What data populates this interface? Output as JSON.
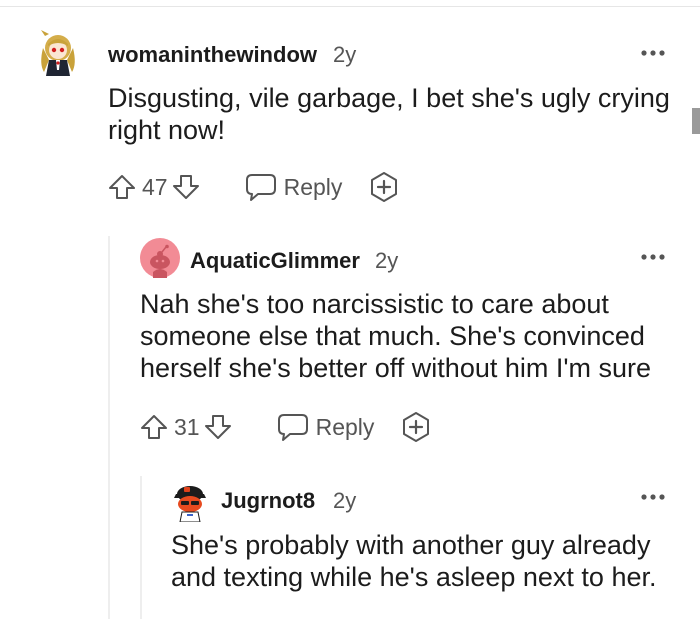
{
  "comments": [
    {
      "username": "womaninthewindow",
      "age": "2y",
      "avatar_icon": "anime-girl-avatar-icon",
      "body_lines": [
        "Disgusting, vile garbage, I bet she's ugly crying",
        "right now!"
      ],
      "upvotes": "47",
      "reply_label": "Reply"
    },
    {
      "username": "AquaticGlimmer",
      "age": "2y",
      "avatar_icon": "pink-snoo-avatar-icon",
      "avatar_color": "#f28b95",
      "body_lines": [
        "Nah she's too narcissistic to care about",
        "someone else that much. She's convinced",
        "herself she's better off without him I'm sure"
      ],
      "upvotes": "31",
      "reply_label": "Reply"
    },
    {
      "username": "Jugrnot8",
      "age": "2y",
      "avatar_icon": "snoo-with-cap-avatar-icon",
      "body_lines": [
        "She's probably with another guy already",
        "and texting while he's asleep next to her."
      ]
    }
  ]
}
